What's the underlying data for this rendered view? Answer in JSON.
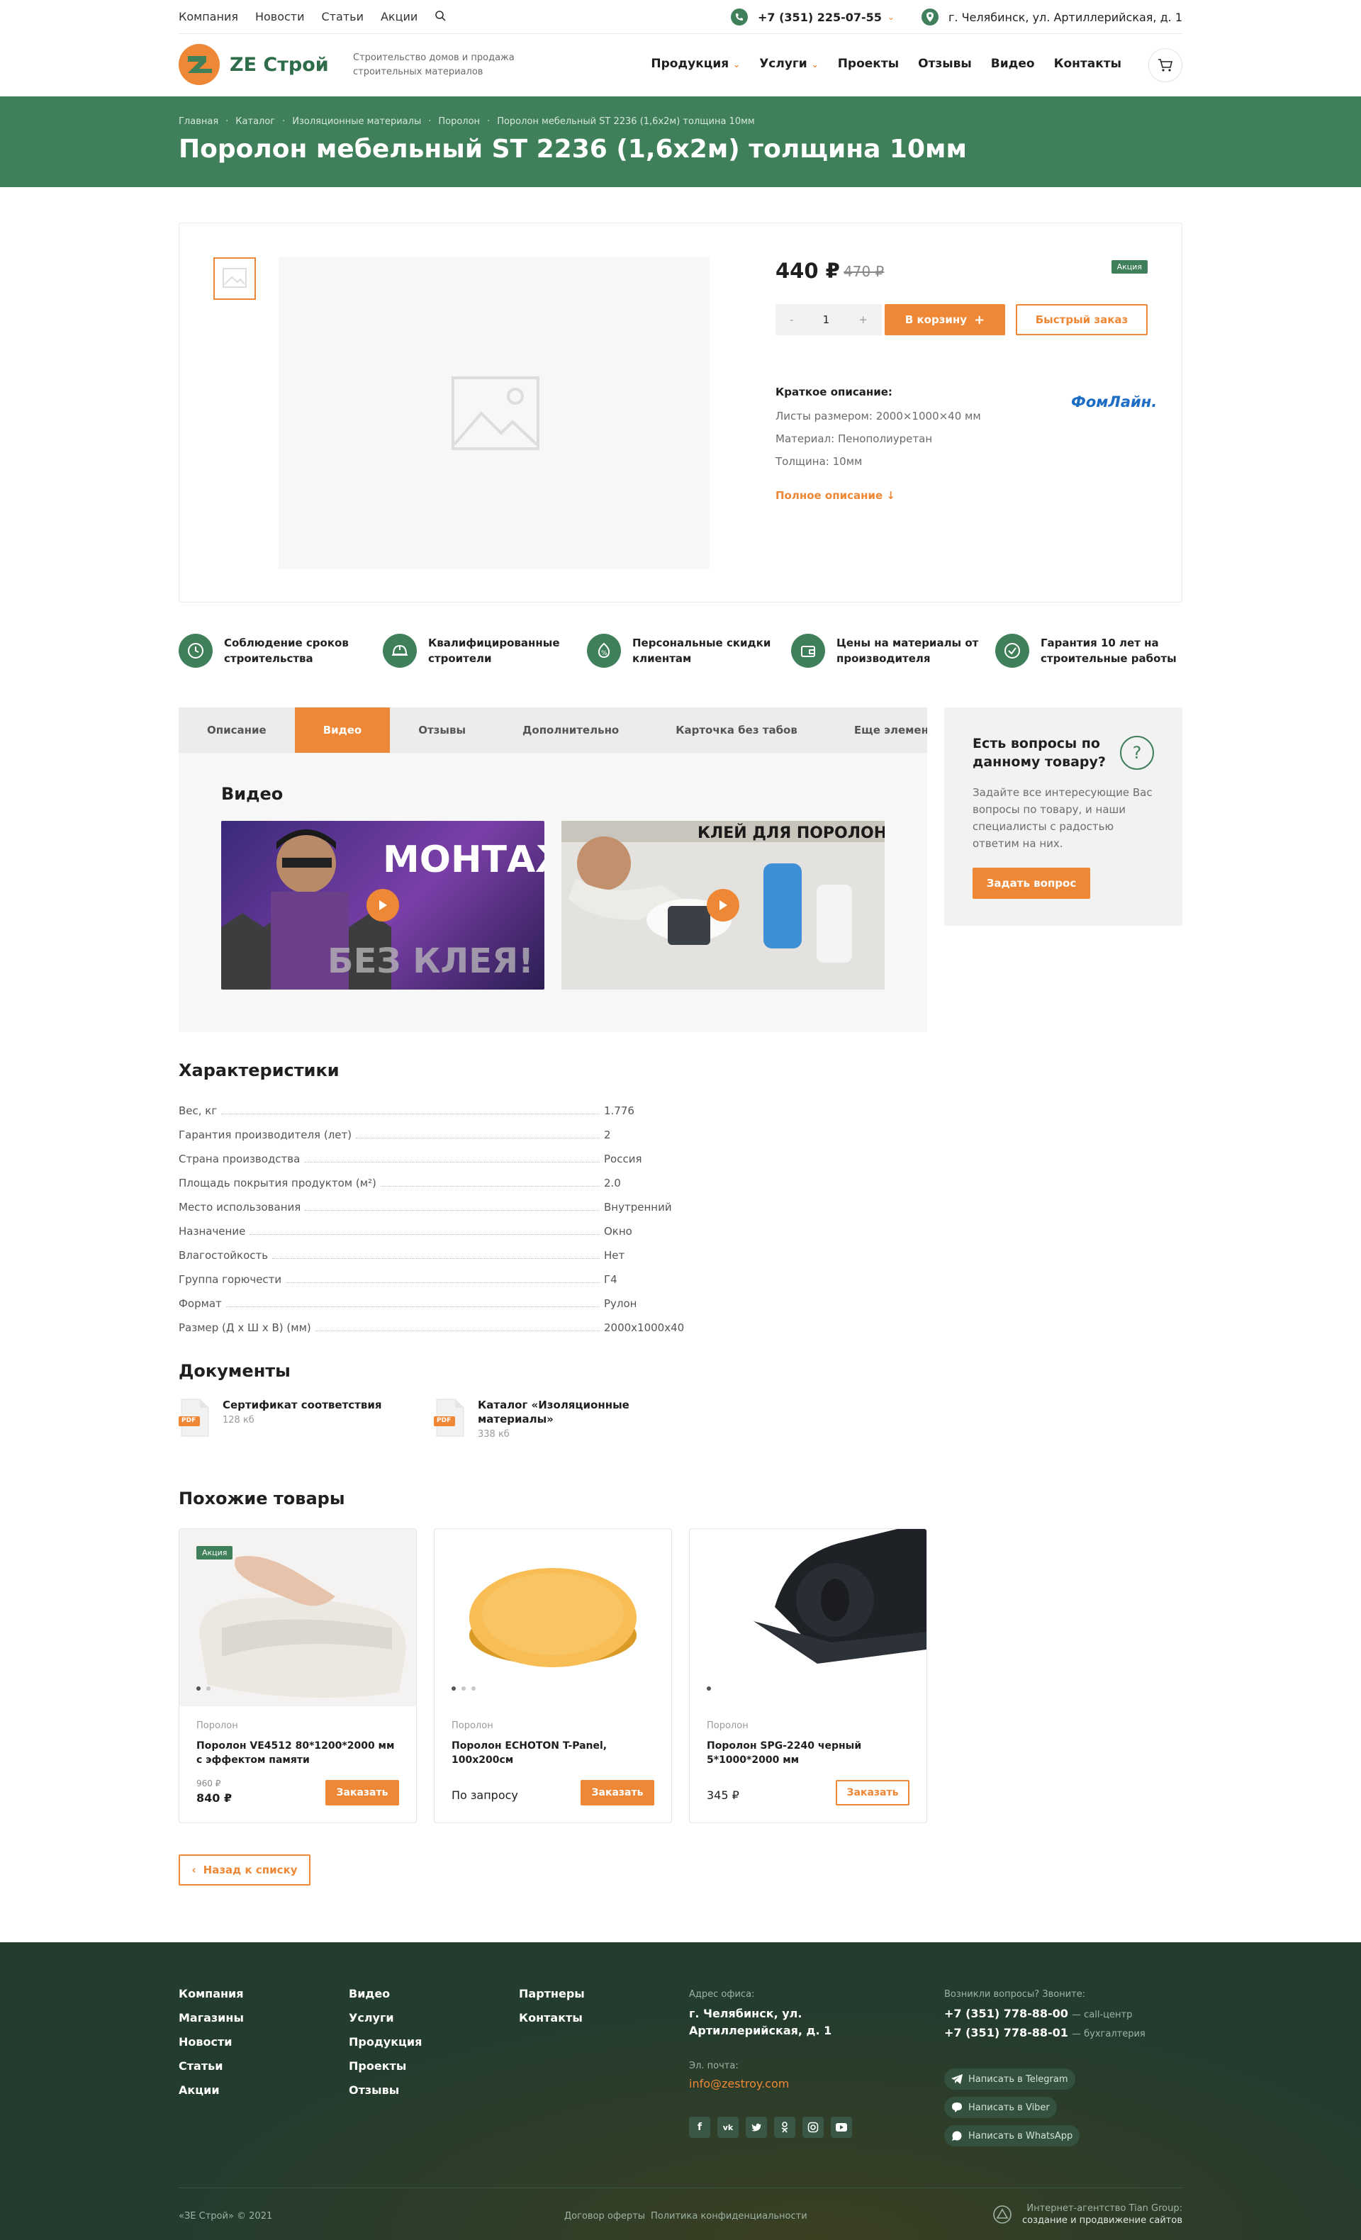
{
  "topbar": {
    "nav": [
      "Компания",
      "Новости",
      "Статьи",
      "Акции"
    ],
    "phone": "+7 (351) 225-07-55",
    "address": "г. Челябинск, ул. Артиллерийская, д. 1"
  },
  "header": {
    "logo_text": "ZE Строй",
    "tagline": "Строительство домов и продажа строительных материалов",
    "nav": [
      "Продукция",
      "Услуги",
      "Проекты",
      "Отзывы",
      "Видео",
      "Контакты"
    ]
  },
  "breadcrumbs": [
    "Главная",
    "Каталог",
    "Изоляционные материалы",
    "Поролон",
    "Поролон мебельный ST 2236 (1,6х2м) толщина 10мм"
  ],
  "page_title": "Поролон мебельный ST 2236 (1,6х2м) толщина 10мм",
  "product": {
    "price": "440 ₽",
    "old_price": "470 ₽",
    "badge": "Акция",
    "qty_minus": "-",
    "qty": "1",
    "qty_plus": "+",
    "cart_label": "В корзину",
    "quick_label": "Быстрый заказ",
    "short_title": "Краткое описание:",
    "short_lines": [
      "Листы размером: 2000×1000×40 мм",
      "Материал: Пенополиуретан",
      "Толщина: 10мм"
    ],
    "full_desc": "Полное описание",
    "brand": "ФомЛайн."
  },
  "features": [
    "Соблюдение сроков строительства",
    "Квалифицированные строители",
    "Персональные скидки клиентам",
    "Цены на материалы от производителя",
    "Гарантия 10 лет на строительные работы"
  ],
  "tabs": [
    "Описание",
    "Видео",
    "Отзывы",
    "Дополнительно",
    "Карточка без табов",
    "Еще элемент для"
  ],
  "video_section": {
    "title": "Видео",
    "video1_text_top": "МОНТАЖ",
    "video1_text_bottom": "БЕЗ КЛЕЯ!",
    "video2_text": "КЛЕЙ ДЛЯ ПОРОЛОНА"
  },
  "question": {
    "title": "Есть вопросы по данному товару?",
    "icon": "?",
    "text": "Задайте все интересующие Вас вопросы по товару, и наши специалисты с радостью ответим на них.",
    "button": "Задать вопрос"
  },
  "specs": {
    "title": "Характеристики",
    "rows": [
      {
        "name": "Вес, кг",
        "value": "1.776"
      },
      {
        "name": "Гарантия производителя (лет)",
        "value": "2"
      },
      {
        "name": "Страна производства",
        "value": "Россия"
      },
      {
        "name": "Площадь покрытия продуктом (м²)",
        "value": "2.0"
      },
      {
        "name": "Место использования",
        "value": "Внутренний"
      },
      {
        "name": "Назначение",
        "value": "Окно"
      },
      {
        "name": "Влагостойкость",
        "value": "Нет"
      },
      {
        "name": "Группа горючести",
        "value": "Г4"
      },
      {
        "name": "Формат",
        "value": "Рулон"
      },
      {
        "name": "Размер (Д х Ш х В) (мм)",
        "value": "2000х1000х40"
      }
    ]
  },
  "documents": {
    "title": "Документы",
    "label": "PDF",
    "items": [
      {
        "name": "Сертификат соответствия",
        "size": "128 кб"
      },
      {
        "name": "Каталог «Изоляционные материалы»",
        "size": "338 кб"
      }
    ]
  },
  "similar": {
    "title": "Похожие товары",
    "items": [
      {
        "badge": "Акция",
        "category": "Поролон",
        "name": "Поролон VE4512 80*1200*2000 мм с эффектом памяти",
        "old_price": "960 ₽",
        "price": "840 ₽",
        "button": "Заказать"
      },
      {
        "category": "Поролон",
        "name": "Поролон ECHOTON T-Panel, 100х200см",
        "price": "По запросу",
        "button": "Заказать"
      },
      {
        "category": "Поролон",
        "name": "Поролон SPG-2240 черный 5*1000*2000 мм",
        "price": "345 ₽",
        "button": "Заказать"
      }
    ]
  },
  "back_label": "Назад к списку",
  "footer": {
    "col1": [
      "Компания",
      "Магазины",
      "Новости",
      "Статьи",
      "Акции"
    ],
    "col2": [
      "Видео",
      "Услуги",
      "Продукция",
      "Проекты",
      "Отзывы"
    ],
    "col3": [
      "Партнеры",
      "Контакты"
    ],
    "office_label": "Адрес офиса:",
    "office": "г. Челябинск, ул. Артиллерийская, д. 1",
    "email_label": "Эл. почта:",
    "email": "info@zestroy.com",
    "socials": [
      "f",
      "vk",
      "tw",
      "ok",
      "ig",
      "yt"
    ],
    "call_label": "Возникли вопросы? Звоните:",
    "phones": [
      {
        "number": "+7 (351) 778-88-00",
        "note": "— call-центр"
      },
      {
        "number": "+7 (351) 778-88-01",
        "note": "— бухгалтерия"
      }
    ],
    "messengers": [
      "Написать в Telegram",
      "Написать в Viber",
      "Написать в WhatsApp"
    ],
    "copyright": "«ЗЕ Строй» © 2021",
    "offer": "Договор оферты",
    "privacy": "Политика конфиденциальности",
    "agency_line1": "Интернет-агентство Tian Group:",
    "agency_line2": "создание и продвижение сайтов"
  },
  "colors": {
    "green": "#3f7f5a",
    "orange": "#ee8836",
    "footer": "#243c2e"
  }
}
